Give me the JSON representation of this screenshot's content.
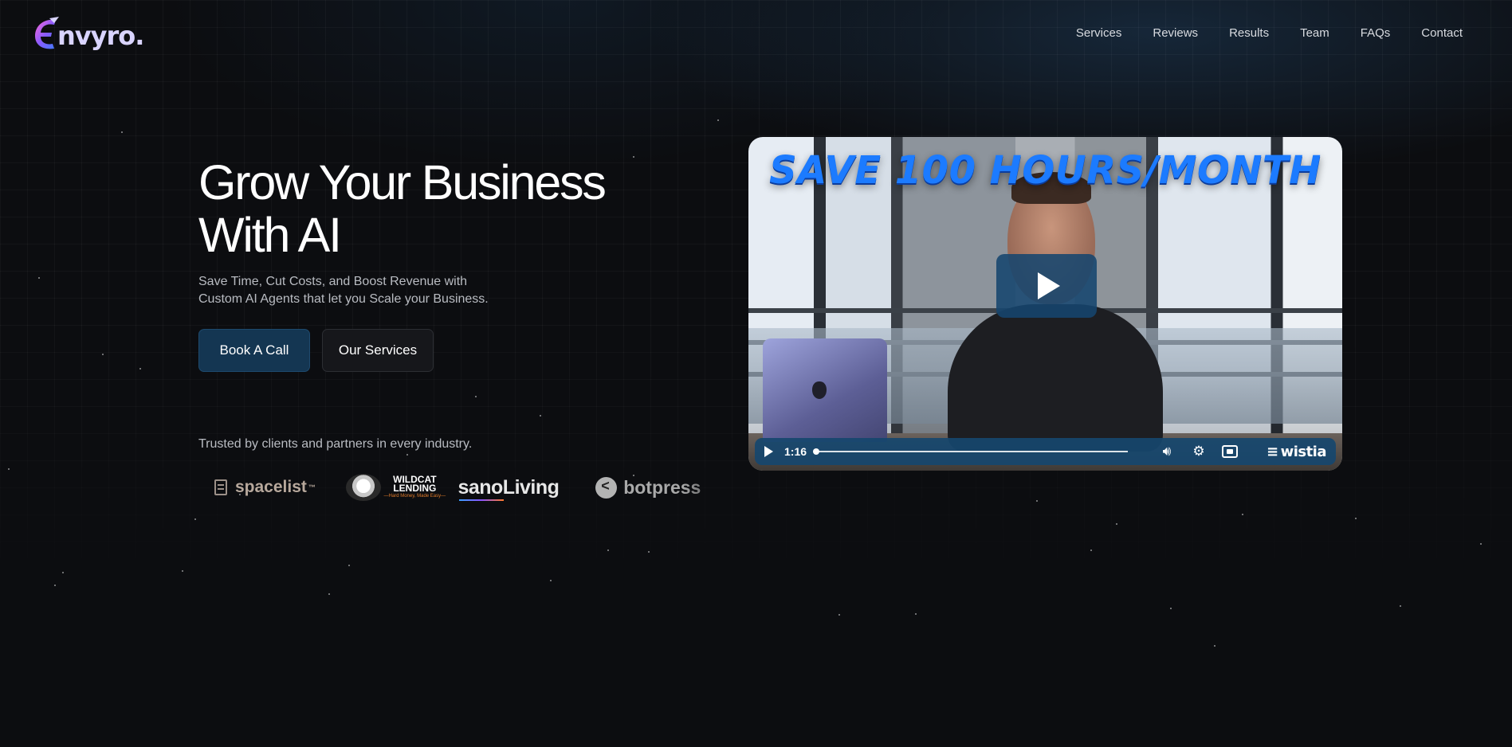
{
  "brand": {
    "logo_letter": "E",
    "logo_text": "nvyro."
  },
  "nav": {
    "items": [
      {
        "label": "Services"
      },
      {
        "label": "Reviews"
      },
      {
        "label": "Results"
      },
      {
        "label": "Team"
      },
      {
        "label": "FAQs"
      },
      {
        "label": "Contact"
      }
    ]
  },
  "hero": {
    "title_line1": "Grow Your Business",
    "title_line2": "With AI",
    "subtitle_line1": "Save Time, Cut Costs, and Boost Revenue with",
    "subtitle_line2": "Custom AI Agents that let you Scale your Business.",
    "primary_button": "Book A Call",
    "secondary_button": "Our Services"
  },
  "trusted": {
    "text": "Trusted by clients and partners in every industry.",
    "clients": [
      {
        "name": "spacelist",
        "mark": "™"
      },
      {
        "name": "WILDCAT",
        "name2": "LENDING",
        "tagline": "—Hard Money, Made Easy—"
      },
      {
        "name": "sanoLiving"
      },
      {
        "name": "botpress"
      }
    ]
  },
  "video": {
    "headline": "SAVE 100 HOURS/MONTH",
    "time": "1:16",
    "player_brand": "wistia",
    "progress": 0.0
  },
  "colors": {
    "background": "#0c0d10",
    "primary_button": "#143652",
    "headline_blue": "#1c7bff",
    "player_blue": "#16466e"
  }
}
